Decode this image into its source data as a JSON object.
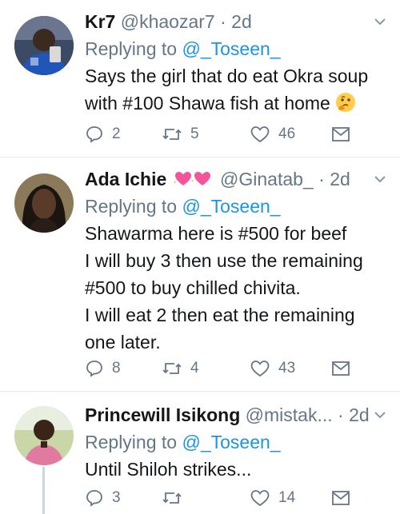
{
  "tweets": [
    {
      "name": "Kr7",
      "handle": "@khaozar7",
      "dot": "·",
      "time": "2d",
      "replying_prefix": "Replying to ",
      "replying_to": "@_Toseen_",
      "text_lines": [
        "Says the girl that do eat Okra soup",
        "with #100 Shawa fish at home"
      ],
      "emoji": "thinking-face-icon",
      "replies": "2",
      "retweets": "5",
      "likes": "46"
    },
    {
      "name": "Ada Ichie",
      "name_emoji": "sparkling-hearts-icon",
      "handle": "@Ginatab_",
      "dot": "·",
      "time": "2d",
      "replying_prefix": "Replying to ",
      "replying_to": "@_Toseen_",
      "text_lines": [
        "Shawarma here is #500 for beef",
        "I will buy 3 then use the remaining",
        "#500 to buy chilled chivita.",
        "I will eat 2 then eat the remaining",
        "one later."
      ],
      "replies": "8",
      "retweets": "4",
      "likes": "43"
    },
    {
      "name": "Princewill Isikong",
      "handle": "@mistak...",
      "dot": "·",
      "time": "2d",
      "replying_prefix": "Replying to ",
      "replying_to": "@_Toseen_",
      "text_lines": [
        "Until Shiloh strikes..."
      ],
      "replies": "3",
      "retweets": "",
      "likes": "14"
    }
  ],
  "colors": {
    "text": "#14171a",
    "muted": "#657786",
    "link": "#1b95e0",
    "divider": "#e6ecf0"
  }
}
